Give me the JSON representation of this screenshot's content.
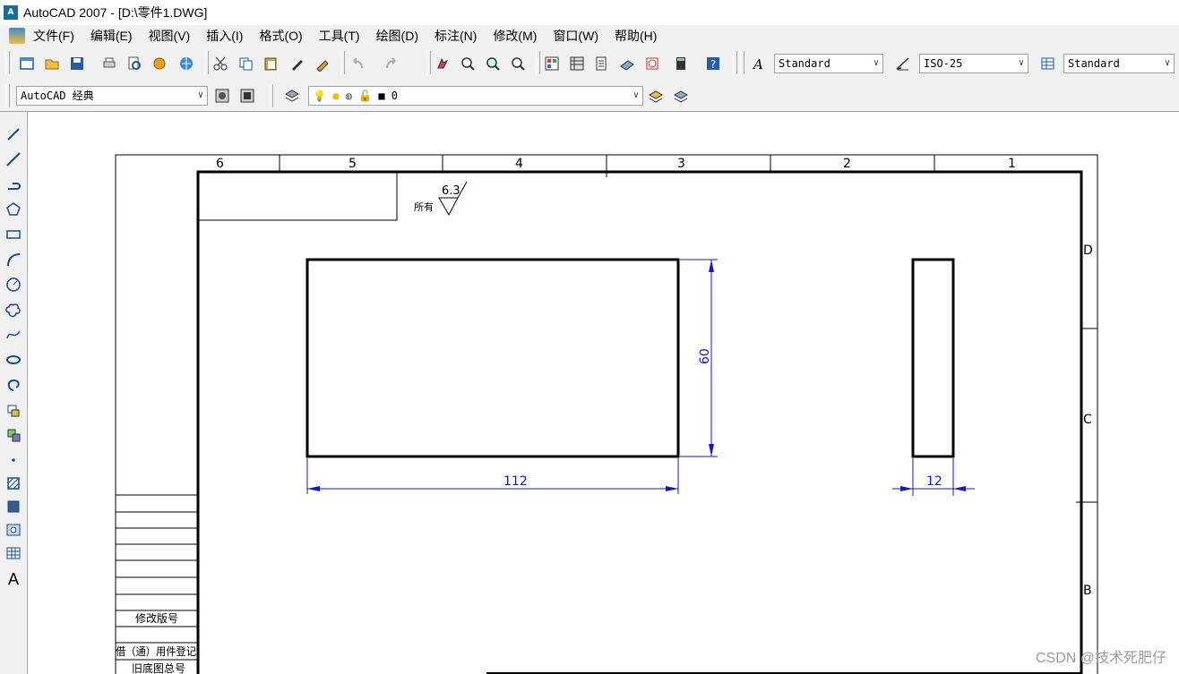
{
  "window": {
    "title": "AutoCAD 2007 - [D:\\零件1.DWG]"
  },
  "menu": [
    "文件(F)",
    "编辑(E)",
    "视图(V)",
    "插入(I)",
    "格式(O)",
    "工具(T)",
    "绘图(D)",
    "标注(N)",
    "修改(M)",
    "窗口(W)",
    "帮助(H)"
  ],
  "styles": {
    "text_style": "Standard",
    "dim_style": "ISO-25",
    "table_style": "Standard"
  },
  "workspace": {
    "name": "AutoCAD 经典"
  },
  "layer": {
    "current": "0"
  },
  "drawing": {
    "zone_numbers": [
      "6",
      "5",
      "4",
      "3",
      "2",
      "1"
    ],
    "zone_letters": [
      "D",
      "C",
      "B"
    ],
    "roughness_value": "6.3",
    "roughness_label": "所有",
    "dim_width": "112",
    "dim_height": "60",
    "dim_thickness": "12",
    "table_label_1": "修改版号",
    "table_label_2": "借（通）用件登记",
    "table_label_3": "旧底图总号"
  },
  "watermark": "CSDN @技术死肥仔",
  "colors": {
    "dimension": "#1414cc",
    "outline": "#000000",
    "toolbar_bg": "#f0f0f0"
  }
}
